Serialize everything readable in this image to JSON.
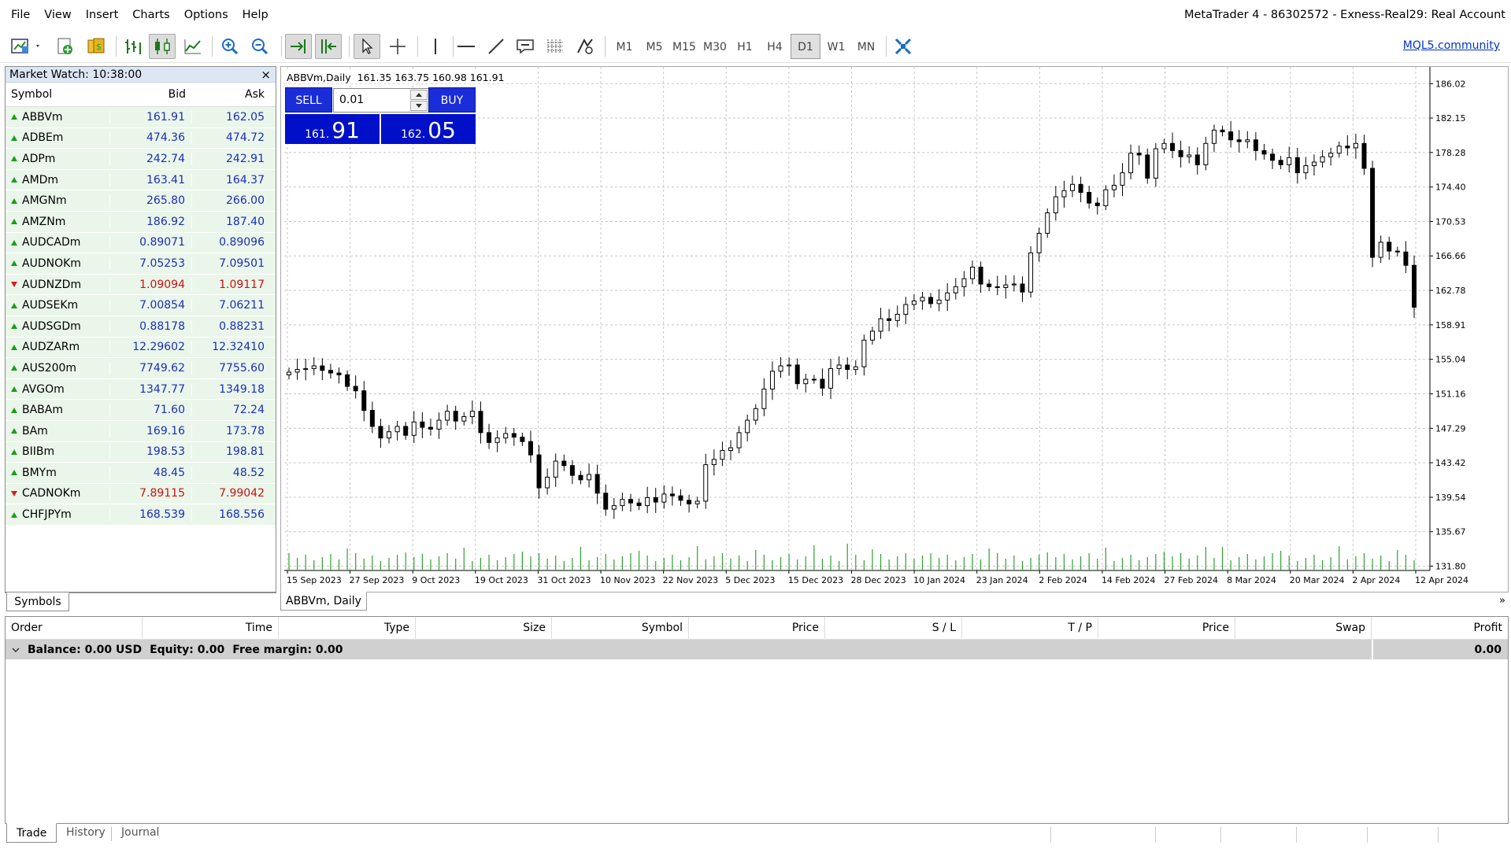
{
  "menu": [
    "File",
    "View",
    "Insert",
    "Charts",
    "Options",
    "Help"
  ],
  "app_title": "MetaTrader 4 - 86302572 - Exness-Real29: Real Account",
  "toolbar": {
    "timeframes": [
      "M1",
      "M5",
      "M15",
      "M30",
      "H1",
      "H4",
      "D1",
      "W1",
      "MN"
    ],
    "active_timeframe": "D1",
    "mql5_link": "MQL5.community"
  },
  "market_watch": {
    "title": "Market Watch: 10:38:00",
    "close": "×",
    "columns": [
      "Symbol",
      "Bid",
      "Ask"
    ],
    "rows": [
      {
        "symbol": "ABBVm",
        "bid": "161.91",
        "ask": "162.05",
        "dir": "up"
      },
      {
        "symbol": "ADBEm",
        "bid": "474.36",
        "ask": "474.72",
        "dir": "up"
      },
      {
        "symbol": "ADPm",
        "bid": "242.74",
        "ask": "242.91",
        "dir": "up"
      },
      {
        "symbol": "AMDm",
        "bid": "163.41",
        "ask": "164.37",
        "dir": "up"
      },
      {
        "symbol": "AMGNm",
        "bid": "265.80",
        "ask": "266.00",
        "dir": "up"
      },
      {
        "symbol": "AMZNm",
        "bid": "186.92",
        "ask": "187.40",
        "dir": "up"
      },
      {
        "symbol": "AUDCADm",
        "bid": "0.89071",
        "ask": "0.89096",
        "dir": "up"
      },
      {
        "symbol": "AUDNOKm",
        "bid": "7.05253",
        "ask": "7.09501",
        "dir": "up"
      },
      {
        "symbol": "AUDNZDm",
        "bid": "1.09094",
        "ask": "1.09117",
        "dir": "down"
      },
      {
        "symbol": "AUDSEKm",
        "bid": "7.00854",
        "ask": "7.06211",
        "dir": "up"
      },
      {
        "symbol": "AUDSGDm",
        "bid": "0.88178",
        "ask": "0.88231",
        "dir": "up"
      },
      {
        "symbol": "AUDZARm",
        "bid": "12.29602",
        "ask": "12.32410",
        "dir": "up"
      },
      {
        "symbol": "AUS200m",
        "bid": "7749.62",
        "ask": "7755.60",
        "dir": "up"
      },
      {
        "symbol": "AVGOm",
        "bid": "1347.77",
        "ask": "1349.18",
        "dir": "up"
      },
      {
        "symbol": "BABAm",
        "bid": "71.60",
        "ask": "72.24",
        "dir": "up"
      },
      {
        "symbol": "BAm",
        "bid": "169.16",
        "ask": "173.78",
        "dir": "up"
      },
      {
        "symbol": "BIIBm",
        "bid": "198.53",
        "ask": "198.81",
        "dir": "up"
      },
      {
        "symbol": "BMYm",
        "bid": "48.45",
        "ask": "48.52",
        "dir": "up"
      },
      {
        "symbol": "CADNOKm",
        "bid": "7.89115",
        "ask": "7.99042",
        "dir": "down"
      },
      {
        "symbol": "CHFJPYm",
        "bid": "168.539",
        "ask": "168.556",
        "dir": "up"
      }
    ],
    "tab": "Symbols"
  },
  "chart": {
    "header": "ABBVm,Daily",
    "ohlc": "161.35 163.75 160.98 161.91",
    "tab": "ABBVm, Daily",
    "one_click": {
      "sell_label": "SELL",
      "buy_label": "BUY",
      "lot": "0.01",
      "sell_small": "161.",
      "sell_big": "91",
      "buy_small": "162.",
      "buy_big": "05"
    }
  },
  "chart_data": {
    "type": "candlestick",
    "symbol": "ABBVm",
    "timeframe": "Daily",
    "ylim": [
      129.9,
      187.9
    ],
    "y_ticks": [
      "186.02",
      "182.15",
      "178.28",
      "174.40",
      "170.53",
      "166.66",
      "162.78",
      "158.91",
      "155.04",
      "151.16",
      "147.29",
      "143.42",
      "139.54",
      "135.67",
      "131.80"
    ],
    "x_ticks": [
      "15 Sep 2023",
      "27 Sep 2023",
      "9 Oct 2023",
      "19 Oct 2023",
      "31 Oct 2023",
      "10 Nov 2023",
      "22 Nov 2023",
      "5 Dec 2023",
      "15 Dec 2023",
      "28 Dec 2023",
      "10 Jan 2024",
      "23 Jan 2024",
      "2 Feb 2024",
      "14 Feb 2024",
      "27 Feb 2024",
      "8 Mar 2024",
      "20 Mar 2024",
      "2 Apr 2024",
      "12 Apr 2024"
    ],
    "grid": true,
    "closes": [
      153.6,
      153.9,
      154.0,
      154.3,
      153.8,
      153.5,
      153.3,
      152.0,
      151.5,
      149.3,
      147.5,
      146.2,
      146.9,
      147.5,
      146.5,
      148.0,
      147.4,
      147.2,
      148.2,
      149.2,
      148.1,
      148.6,
      149.2,
      146.8,
      145.7,
      146.2,
      146.7,
      146.3,
      145.8,
      144.3,
      140.6,
      141.8,
      143.6,
      143.1,
      142.0,
      141.5,
      142.1,
      140.0,
      138.2,
      138.6,
      139.3,
      138.9,
      138.6,
      139.5,
      139.0,
      139.9,
      139.7,
      139.2,
      138.8,
      139.1,
      143.2,
      143.8,
      144.8,
      145.1,
      146.8,
      148.2,
      149.5,
      151.7,
      153.7,
      154.3,
      154.4,
      152.3,
      152.8,
      152.8,
      151.8,
      154.0,
      154.4,
      153.9,
      154.2,
      157.2,
      158.2,
      159.6,
      159.4,
      160.1,
      161.2,
      161.6,
      162.0,
      161.3,
      161.7,
      162.5,
      163.2,
      164.1,
      165.4,
      163.5,
      163.2,
      163.1,
      163.4,
      163.5,
      162.6,
      167.0,
      169.2,
      171.5,
      173.3,
      174.0,
      174.7,
      173.8,
      172.6,
      172.3,
      174.1,
      174.6,
      176.0,
      178.2,
      178.0,
      175.4,
      178.7,
      179.3,
      178.5,
      177.8,
      178.0,
      176.9,
      179.3,
      180.8,
      180.6,
      179.7,
      179.5,
      179.7,
      178.5,
      178.1,
      177.4,
      176.9,
      177.7,
      176.0,
      176.8,
      177.2,
      177.8,
      178.2,
      179.0,
      178.8,
      179.3,
      176.5,
      166.5,
      168.2,
      167.2,
      167.1,
      165.6,
      160.9
    ],
    "last_close": 161.91,
    "volume_shown": true
  },
  "terminal": {
    "columns": [
      "Order",
      "Time",
      "Type",
      "Size",
      "Symbol",
      "Price",
      "S / L",
      "T / P",
      "Price",
      "Swap",
      "Profit"
    ],
    "balance_text": "Balance: 0.00 USD",
    "equity_text": "Equity: 0.00",
    "free_margin_text": "Free margin: 0.00",
    "profit": "0.00",
    "tabs": [
      "Trade",
      "History",
      "Journal"
    ],
    "active_tab": "Trade"
  },
  "colors": {
    "accent": "#0010c8",
    "up": "#1c9c1c",
    "down": "#d42020",
    "volume": "#2ea02e",
    "quote_up": "#1a2dbe",
    "quote_down": "#cc1111"
  }
}
